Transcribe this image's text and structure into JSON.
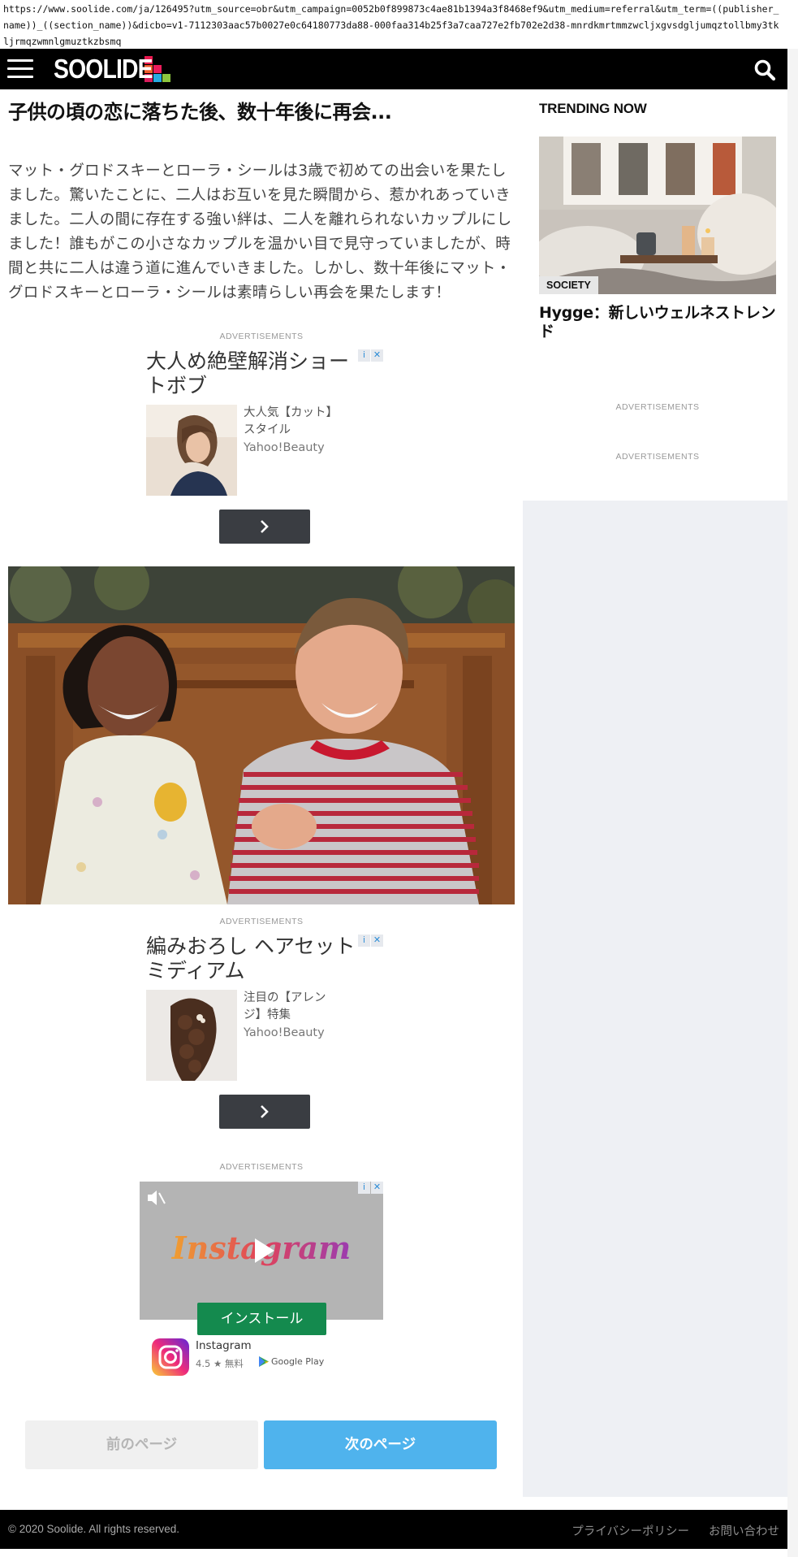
{
  "browser": {
    "url": "https://www.soolide.com/ja/126495?utm_source=obr&utm_campaign=0052b0f899873c4ae81b1394a3f8468ef9&utm_medium=referral&utm_term=((publisher_name))_((section_name))&dicbo=v1-7112303aac57b0027e0c64180773da88-000faa314b25f3a7caa727e2fb702e2d38-mnrdkmrtmmzwcljxgvsdgljumqztollbmy3tkljrmqzwmnlgmuztkzbsmq"
  },
  "header": {
    "logo_text": "SOOLIDE",
    "logo_colors": [
      "#e8194f",
      "#f15a29",
      "#f7941d",
      "#ed1c5b",
      "#ee3b3b",
      "#27aae1",
      "#d91c5c",
      "#8dc63f",
      "#00a99d"
    ],
    "menu_icon": "hamburger-menu-icon",
    "search_icon": "search-icon"
  },
  "article": {
    "title": "子供の頃の恋に落ちた後、数十年後に再会...",
    "body": "マット・グロドスキーとローラ・シールは3歳で初めての出会いを果たしました。驚いたことに、二人はお互いを見た瞬間から、惹かれあっていきました。二人の間に存在する強い絆は、二人を離れられないカップルにしました！誰もがこの小さなカップルを温かい目で見守っていましたが、時間と共に二人は違う道に進んでいきました。しかし、数十年後にマット・グロドスキーとローラ・シールは素晴らしい再会を果たします！"
  },
  "ads": {
    "label": "ADVERTISEMENTS",
    "ad1": {
      "headline": "大人め絶壁解消ショートボブ",
      "description": "大人気【カット】スタイル",
      "source": "Yahoo!Beauty"
    },
    "ad2": {
      "headline": "編みおろし ヘアセット ミディアム",
      "description": "注目の【アレンジ】特集",
      "source": "Yahoo!Beauty"
    },
    "ad3": {
      "video_text": "Instagram",
      "install_label": "インストール",
      "app_name": "Instagram",
      "rating": "4.5 ★ 無料",
      "store": "Google Play"
    },
    "choices_info": "i",
    "choices_close": "✕"
  },
  "pager": {
    "prev_label": "前のページ",
    "next_label": "次のページ"
  },
  "sidebar": {
    "trending_title": "TRENDING NOW",
    "card": {
      "category": "SOCIETY",
      "headline": "Hygge：新しいウェルネストレンド"
    },
    "ad_label_1": "ADVERTISEMENTS",
    "ad_label_2": "ADVERTISEMENTS"
  },
  "footer": {
    "copyright": "© 2020 Soolide. All rights reserved.",
    "privacy_link": "プライバシーポリシー",
    "contact_link": "お問い合わせ"
  }
}
